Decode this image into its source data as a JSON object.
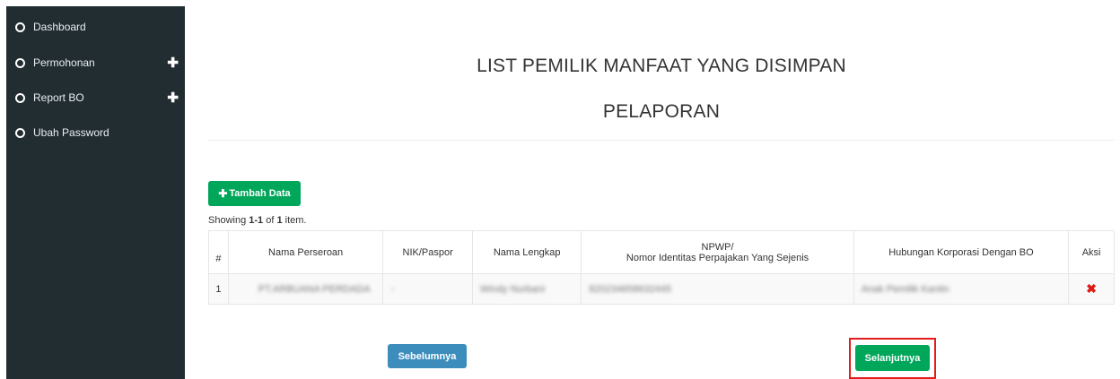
{
  "sidebar": {
    "items": [
      {
        "label": "Dashboard",
        "expandable": false
      },
      {
        "label": "Permohonan",
        "expandable": true
      },
      {
        "label": "Report BO",
        "expandable": true
      },
      {
        "label": "Ubah Password",
        "expandable": false
      }
    ]
  },
  "main": {
    "title_line1": "LIST PEMILIK MANFAAT YANG DISIMPAN",
    "title_line2": "PELAPORAN",
    "add_button_label": "Tambah Data",
    "summary": {
      "prefix": "Showing ",
      "range": "1-1",
      "middle": " of ",
      "count": "1",
      "suffix": " item."
    },
    "table": {
      "headers": [
        "#",
        "Nama Perseroan",
        "NIK/Paspor",
        "Nama Lengkap",
        "NPWP/",
        "Nomor Identitas Perpajakan Yang Sejenis",
        "Hubungan Korporasi Dengan BO",
        "Aksi"
      ],
      "rows": [
        [
          "1",
          "PT.ARBUANA PERDADA",
          "-",
          "Windy Nurbani",
          "820234658632445",
          "Anak Pemilik Kantin"
        ]
      ]
    },
    "prev_button_label": "Sebelumnya",
    "next_button_label": "Selanjutnya"
  },
  "colors": {
    "sidebar_bg": "#222d32",
    "success": "#00a65a",
    "primary": "#3c8dbc",
    "danger": "#dd1b16",
    "highlight": "#e31b1b"
  },
  "icons": {
    "nav_bullet": "circle-outline-icon",
    "expand": "plus-icon",
    "add": "plus-icon",
    "delete": "x-icon"
  }
}
